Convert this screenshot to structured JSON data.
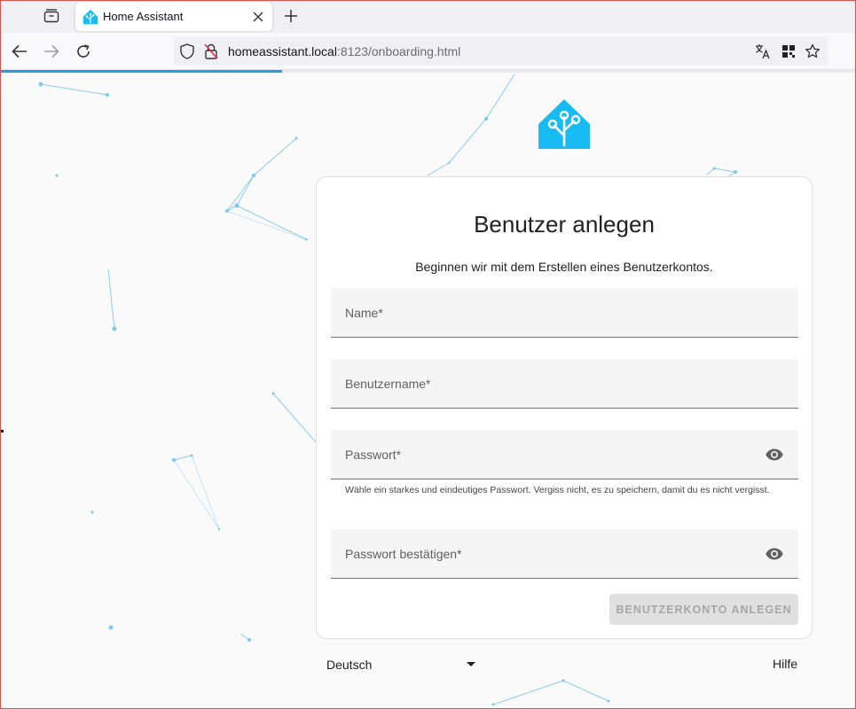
{
  "browser": {
    "tab_title": "Home Assistant",
    "url_host": "homeassistant.local",
    "url_rest": ":8123/onboarding.html",
    "load_progress": 0.33,
    "icons": [
      "tab-overview-icon",
      "home-assistant-favicon",
      "close-icon",
      "plus-icon",
      "back-arrow-icon",
      "forward-arrow-icon",
      "reload-icon",
      "shield-icon",
      "insecure-lock-icon",
      "translate-icon",
      "qr-code-icon",
      "star-icon"
    ]
  },
  "form": {
    "title": "Benutzer anlegen",
    "subtitle": "Beginnen wir mit dem Erstellen eines Benutzerkontos.",
    "name_label": "Name*",
    "username_label": "Benutzername*",
    "password_label": "Passwort*",
    "password_helper": "Wähle ein starkes und eindeutiges Passwort. Vergiss nicht, es zu speichern, damit du es nicht vergisst.",
    "password_confirm_label": "Passwort bestätigen*",
    "submit_label": "BENUTZERKONTO ANLEGEN"
  },
  "footer": {
    "language": "Deutsch",
    "help": "Hilfe"
  },
  "colors": {
    "accent": "#18bcf2",
    "progress": "#1e9fe6",
    "disabled_button": "#e0e0e0"
  }
}
